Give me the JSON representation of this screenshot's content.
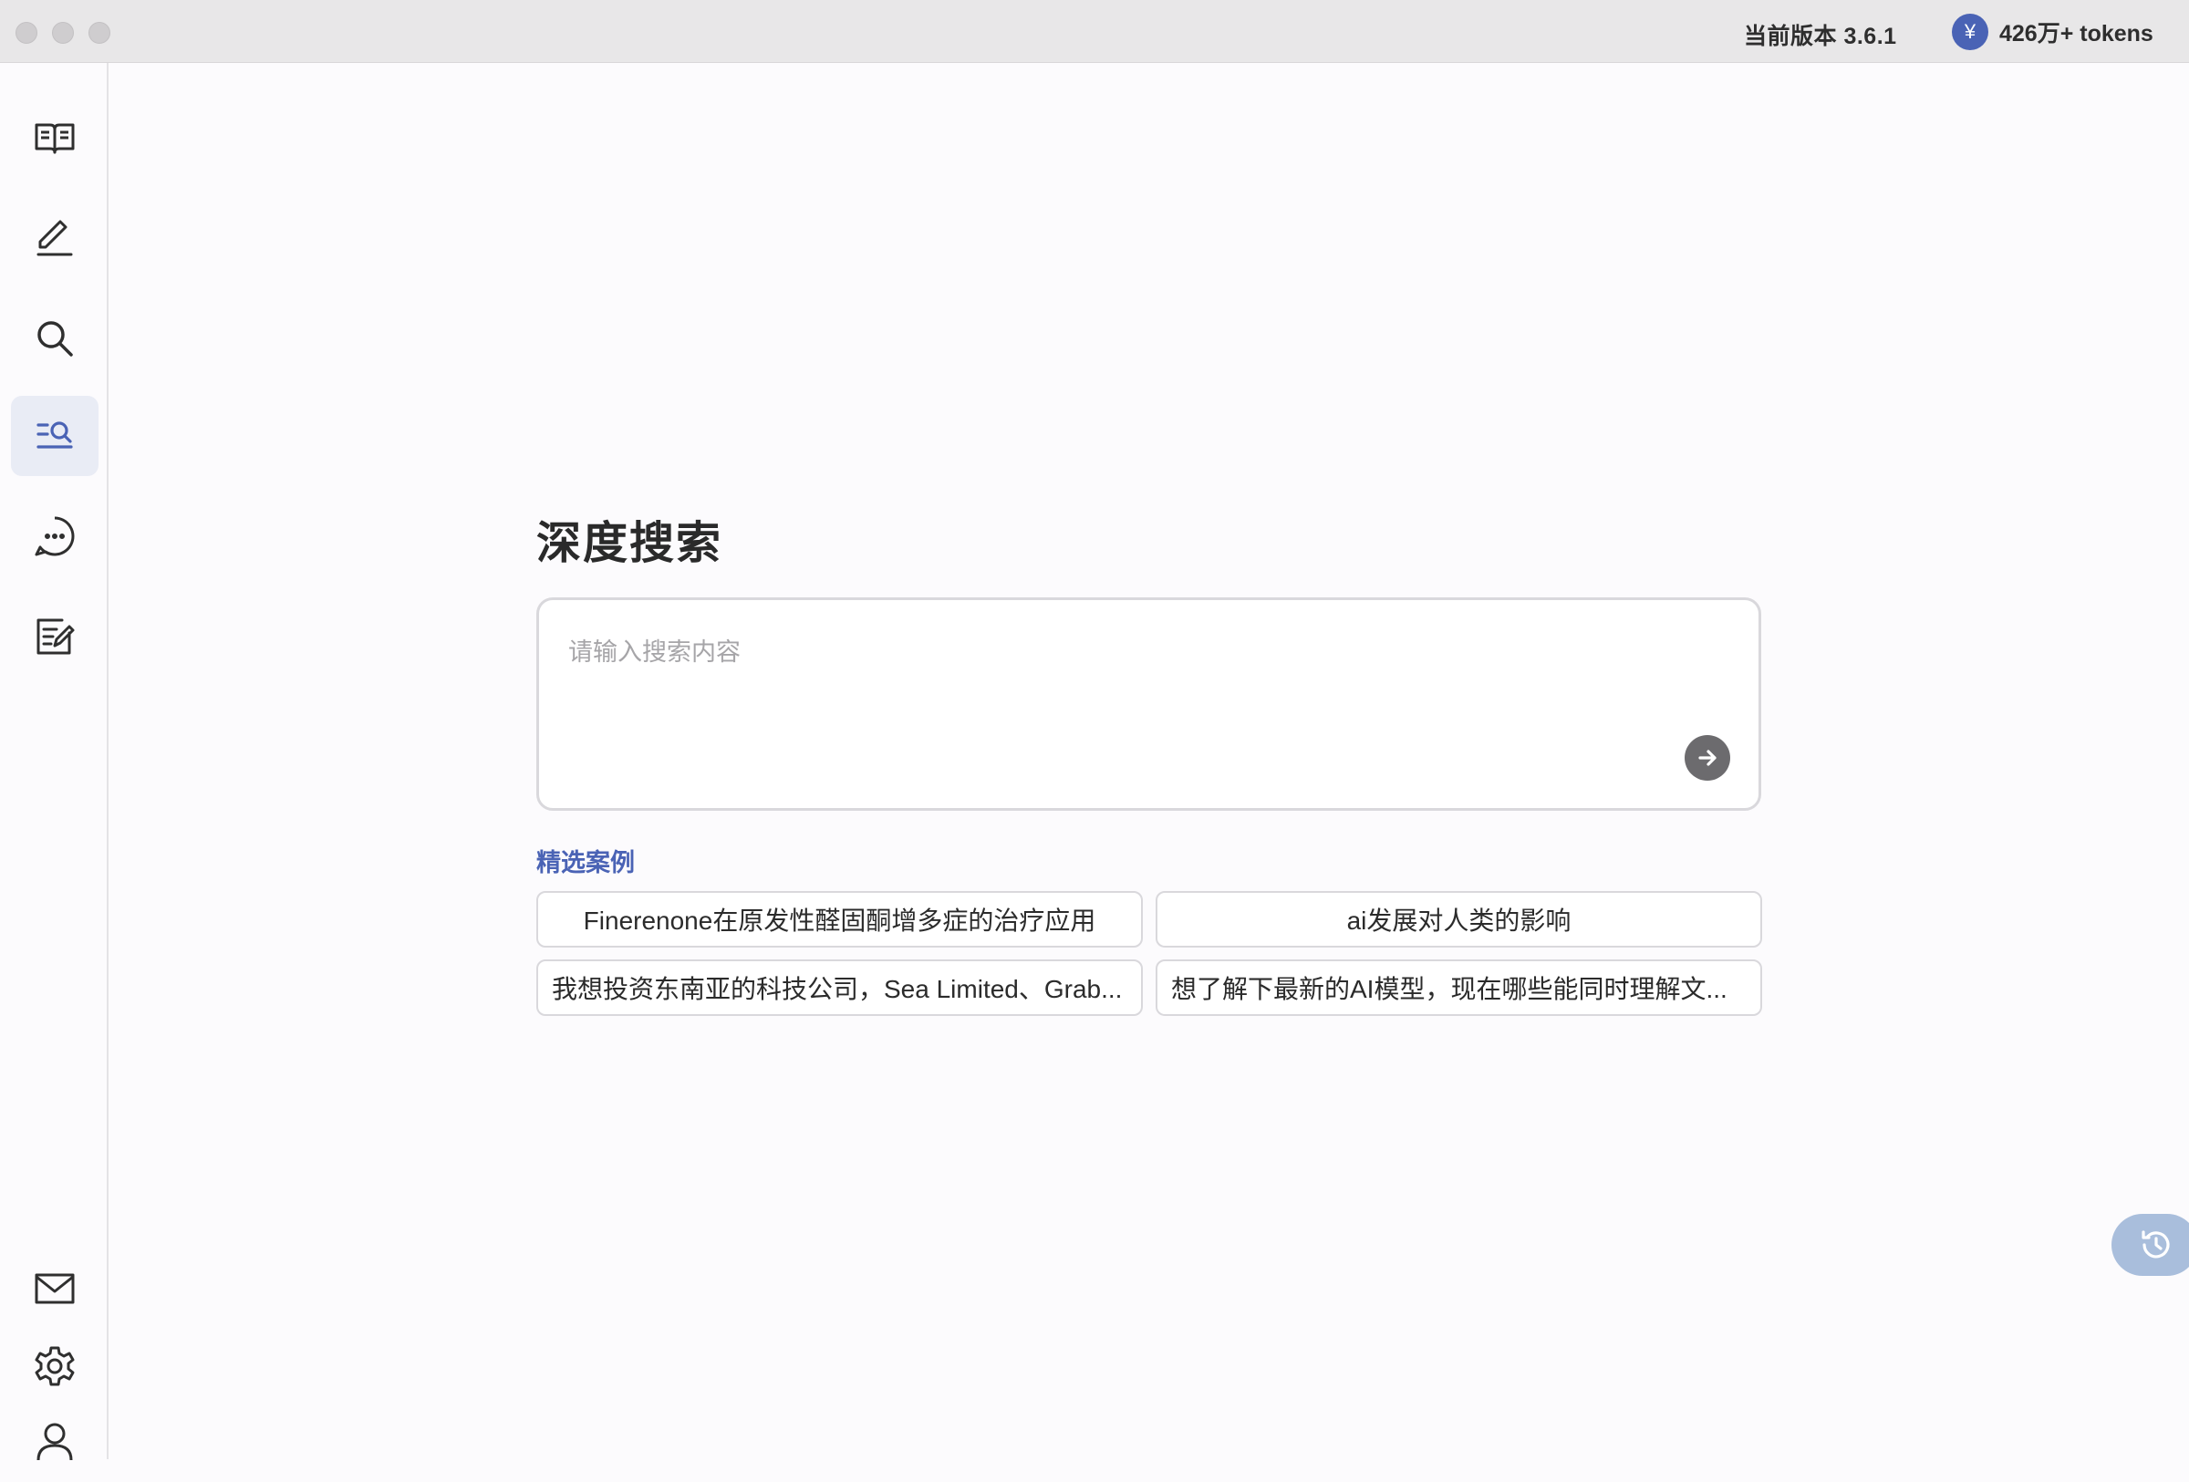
{
  "titlebar": {
    "version": "当前版本 3.6.1",
    "tokens": "426万+ tokens",
    "coin_symbol": "¥"
  },
  "sidebar": {
    "items": [
      {
        "name": "library",
        "icon": "book-open-icon"
      },
      {
        "name": "write",
        "icon": "pen-icon"
      },
      {
        "name": "search",
        "icon": "search-icon"
      },
      {
        "name": "deep-search",
        "icon": "list-search-icon",
        "active": true
      },
      {
        "name": "chat",
        "icon": "chat-bubble-icon"
      },
      {
        "name": "notes",
        "icon": "edit-note-icon"
      }
    ],
    "bottom": [
      {
        "name": "mail",
        "icon": "mail-icon"
      },
      {
        "name": "settings",
        "icon": "gear-icon"
      },
      {
        "name": "profile",
        "icon": "user-icon"
      }
    ]
  },
  "main": {
    "title": "深度搜索",
    "search": {
      "placeholder": "请输入搜索内容",
      "value": ""
    },
    "featured_label": "精选案例",
    "examples": [
      "Finerenone在原发性醛固酮增多症的治疗应用",
      "ai发展对人类的影响",
      "我想投资东南亚的科技公司，Sea Limited、Grab...",
      "想了解下最新的AI模型，现在哪些能同时理解文..."
    ]
  },
  "colors": {
    "accent": "#4a63b5",
    "active_nav_bg": "#e9ecf5",
    "history_button": "#a9bedc"
  }
}
